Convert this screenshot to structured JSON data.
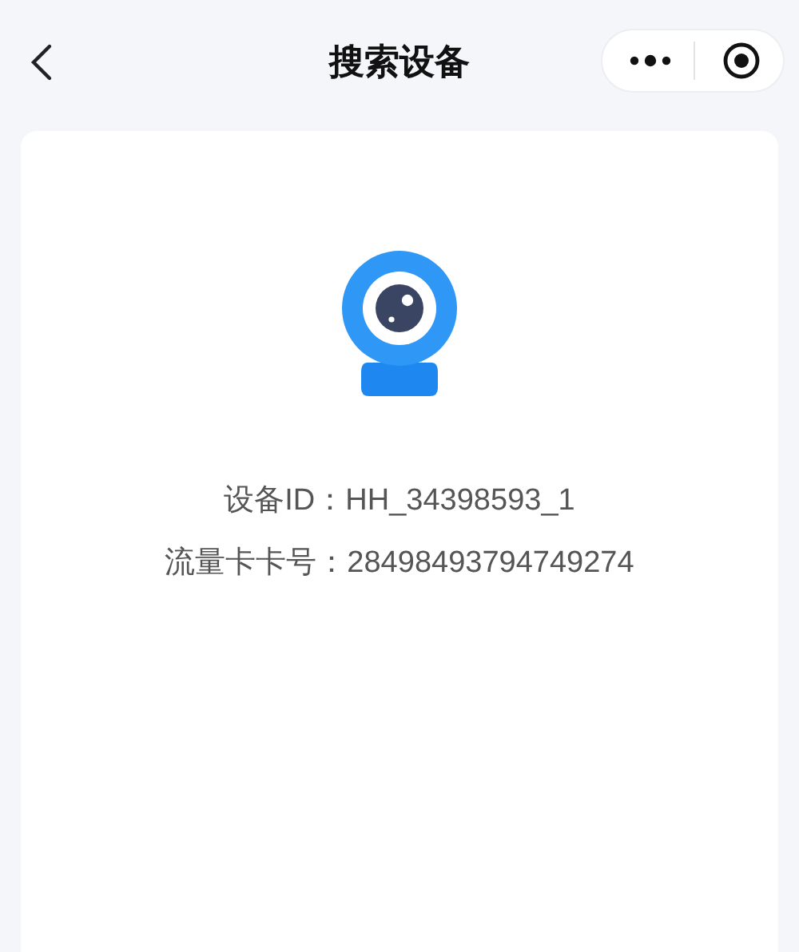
{
  "nav": {
    "title": "搜索设备"
  },
  "device": {
    "id_line": "设备ID：HH_34398593_1",
    "card_line": "流量卡卡号：28498493794749274"
  }
}
